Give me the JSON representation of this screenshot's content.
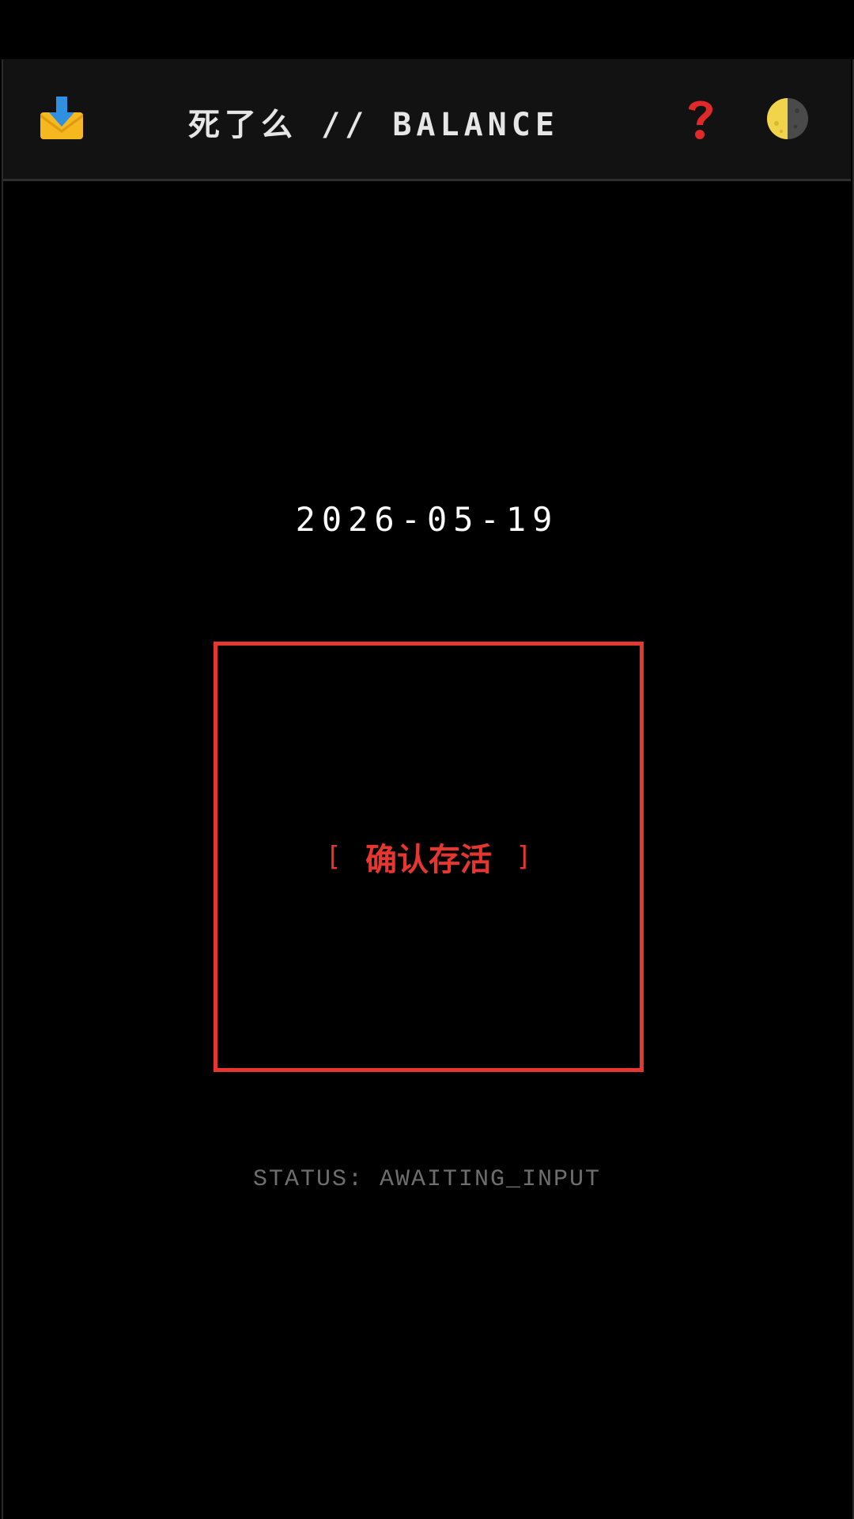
{
  "header": {
    "title": "死了么 // BALANCE",
    "inbox_icon": "inbox-download-icon",
    "help_icon": "question-mark-icon",
    "theme_icon": "half-moon-icon"
  },
  "main": {
    "date": "2026-05-19",
    "confirm": {
      "bracket_left": "[",
      "label": "确认存活",
      "bracket_right": "]"
    },
    "status": "STATUS: AWAITING_INPUT"
  },
  "colors": {
    "background": "#000000",
    "header_background": "#121212",
    "accent_red": "#e5372f",
    "status_gray": "#6e6e6e",
    "text_white": "#ffffff"
  }
}
